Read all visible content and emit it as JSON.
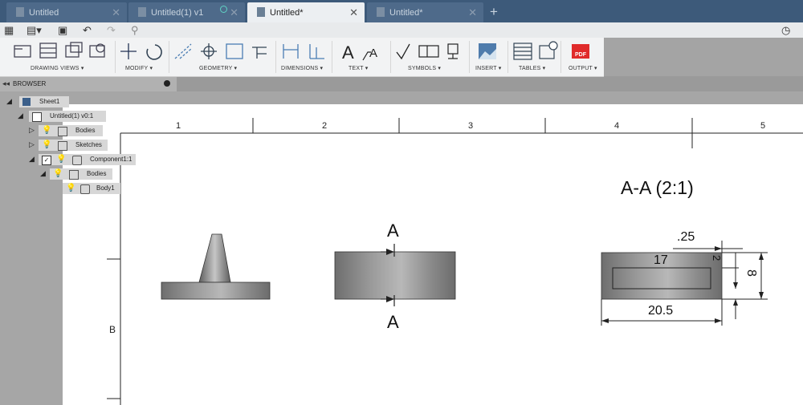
{
  "tabs": [
    {
      "label": "Untitled",
      "active": false
    },
    {
      "label": "Untitled(1) v1",
      "active": false
    },
    {
      "label": "Untitled*",
      "active": true
    },
    {
      "label": "Untitled*",
      "active": false
    }
  ],
  "ribbon": {
    "groups": [
      {
        "label": "DRAWING VIEWS ▾"
      },
      {
        "label": "MODIFY ▾"
      },
      {
        "label": "GEOMETRY ▾"
      },
      {
        "label": "DIMENSIONS ▾"
      },
      {
        "label": "TEXT ▾"
      },
      {
        "label": "SYMBOLS ▾"
      },
      {
        "label": "INSERT ▾"
      },
      {
        "label": "TABLES ▾"
      },
      {
        "label": "OUTPUT ▾"
      }
    ],
    "pdf_label": "PDF"
  },
  "browser": {
    "title": "BROWSER",
    "nodes": [
      {
        "label": "Sheet1"
      },
      {
        "label": "Untitled(1) v0:1"
      },
      {
        "label": "Bodies"
      },
      {
        "label": "Sketches"
      },
      {
        "label": "Component1:1"
      },
      {
        "label": "Bodies"
      },
      {
        "label": "Body1"
      }
    ]
  },
  "sheet": {
    "zones": [
      "1",
      "2",
      "3",
      "4",
      "5"
    ],
    "row_label": "B",
    "section_title": "A-A (2:1)",
    "section_marker_top": "A",
    "section_marker_bottom": "A",
    "dims": {
      "d1": ".25",
      "d2": "17",
      "d3": "20.5",
      "d4": "2",
      "d5": "8"
    }
  },
  "colors": {
    "tabbar": "#3d5a7a",
    "active_tab": "#eceff2",
    "ribbon": "#f2f3f4",
    "body_gray": "#8a8a8a"
  }
}
